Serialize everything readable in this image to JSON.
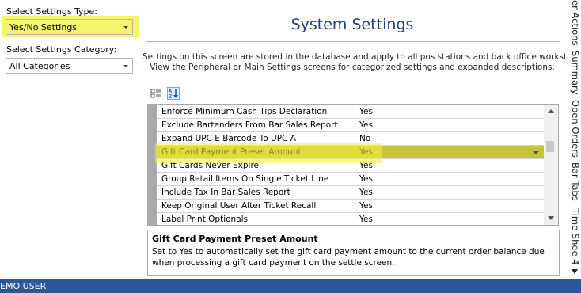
{
  "settings_type": {
    "label": "Select Settings Type:",
    "value": "Yes/No Settings"
  },
  "settings_category": {
    "label": "Select Settings Category:",
    "value": "All Categories"
  },
  "page_title": "System Settings",
  "description_lines": [
    "Settings on this screen are stored in the database and apply to all pos stations and back office workstations.",
    "View the Peripheral or Main Settings screens for categorized settings and expanded descriptions."
  ],
  "toolbar": {
    "categorized_icon": "categorized-icon",
    "alphabetical_icon": "alphabetical-sort-icon",
    "alphabetical_text": "A\nZ"
  },
  "settings_rows": [
    {
      "name": "Enforce Minimum Cash Tips Declaration",
      "value": "Yes"
    },
    {
      "name": "Exclude Bartenders From Bar Sales Report",
      "value": "Yes"
    },
    {
      "name": "Expand UPC E Barcode To UPC A",
      "value": "No"
    },
    {
      "name": "Gift Card Payment Preset Amount",
      "value": "Yes",
      "selected": true
    },
    {
      "name": "Gift Cards Never Expire",
      "value": "Yes"
    },
    {
      "name": "Group Retail Items On Single Ticket Line",
      "value": "Yes"
    },
    {
      "name": "Include Tax In Bar Sales Report",
      "value": "Yes"
    },
    {
      "name": "Keep Original User After Ticket Recall",
      "value": "Yes"
    },
    {
      "name": "Label Print Optionals",
      "value": "Yes"
    }
  ],
  "help": {
    "title": "Gift Card Payment Preset Amount",
    "text": "Set to Yes to automatically set the gift card payment amount to the current order balance due when processing a gift card payment on the settle screen."
  },
  "side_tabs": [
    "er Actions",
    "Summary",
    "Open Orders",
    "Bar Tabs",
    "Time Shee 4"
  ],
  "status_bar": "EMO USER",
  "colors": {
    "highlight": "#f0f03c",
    "title": "#1f3f7a",
    "status_bar": "#2b579a"
  }
}
